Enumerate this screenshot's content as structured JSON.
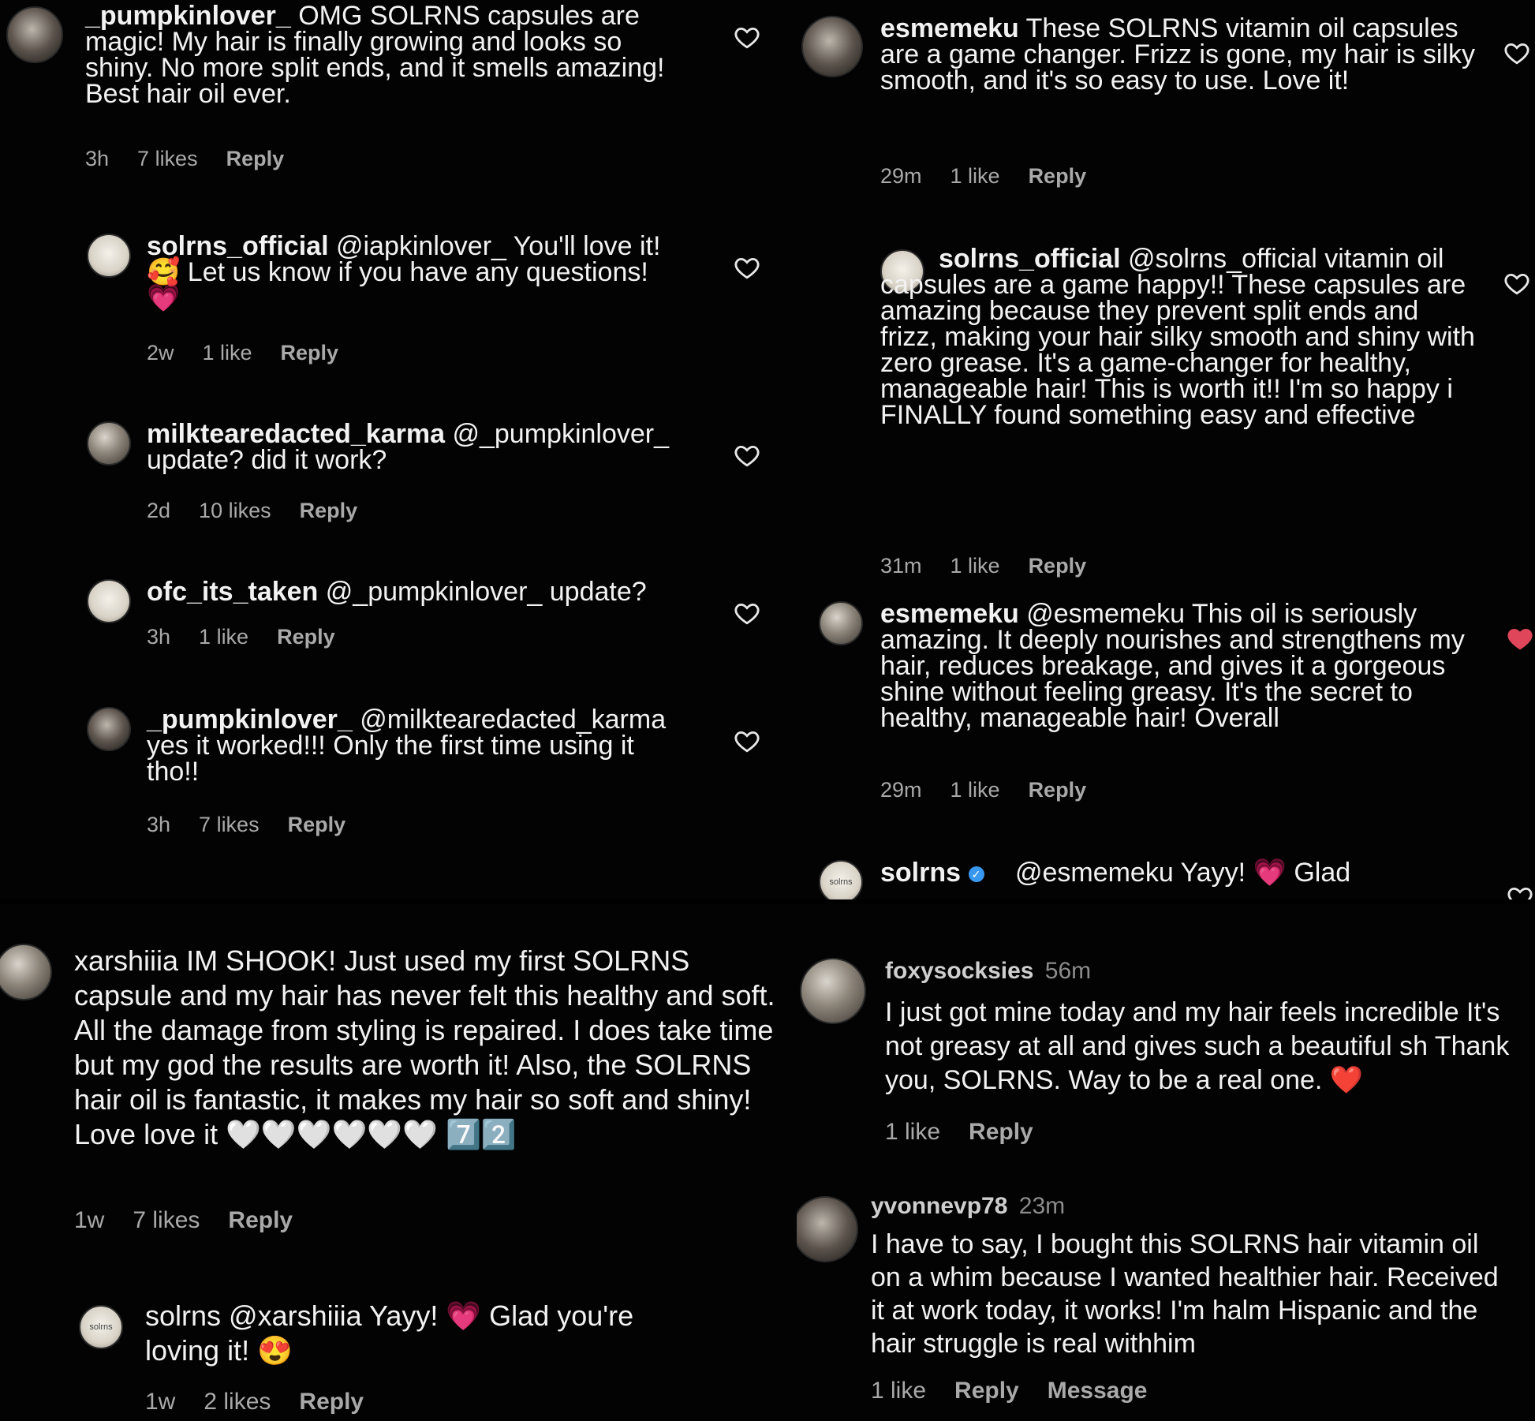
{
  "panels": {
    "top_left": {
      "comments": [
        {
          "username": "_pumpkinlover_",
          "text": "OMG SOLRNS capsules are magic! My hair is finally growing and looks so shiny. No more split ends, and it smells amazing! Best hair oil ever.",
          "time": "3h",
          "likes": "7 likes",
          "reply": "Reply"
        },
        {
          "username": "solrns_official",
          "text": "@iapkinlover_ You'll love it! 🥰 Let us know if you have any questions! 💗",
          "time": "2w",
          "likes": "1 like",
          "reply": "Reply"
        },
        {
          "username": "milktearedacted_karma",
          "text": "@_pumpkinlover_ update? did it work?",
          "time": "2d",
          "likes": "10 likes",
          "reply": "Reply"
        },
        {
          "username": "ofc_its_taken",
          "text": "@_pumpkinlover_ update?",
          "time": "3h",
          "likes": "1 like",
          "reply": "Reply"
        },
        {
          "username": "_pumpkinlover_",
          "text": "@milktearedacted_karma yes it worked!!! Only the first time using it tho!!",
          "time": "3h",
          "likes": "7 likes",
          "reply": "Reply"
        }
      ]
    },
    "top_right": {
      "comments": [
        {
          "username": "esmemeku",
          "text": "These SOLRNS vitamin oil capsules are a game changer. Frizz is gone, my hair is silky smooth, and it's so easy to use. Love it!",
          "time": "29m",
          "likes": "1 like",
          "reply": "Reply"
        },
        {
          "username": "solrns_official",
          "text": "@solrns_official vitamin oil capsules are a game happy!! These capsules are amazing because they prevent split ends and frizz, making your hair silky smooth and shiny with zero grease. It's a game-changer for healthy, manageable hair! This is worth it!! I'm so happy i FINALLY found something easy and effective",
          "time": "31m",
          "likes": "1 like",
          "reply": "Reply"
        },
        {
          "username": "esmemeku",
          "text": "@esmemeku This oil is seriously amazing. It deeply nourishes and strengthens my hair, reduces breakage, and gives it a gorgeous shine without feeling greasy. It's the secret to healthy, manageable hair! Overall",
          "time": "29m",
          "likes": "1 like",
          "reply": "Reply"
        },
        {
          "username": "solrns",
          "text": "@esmemeku Yayy! 💗 Glad",
          "avatar_label": "solrns"
        }
      ]
    },
    "bottom_left": {
      "comments": [
        {
          "username": "xarshiiia",
          "text": "IM SHOOK! Just used my first SOLRNS capsule and my hair has never felt this healthy and soft. All the damage from styling is repaired. I does take time but my god the results are worth it! Also, the SOLRNS hair oil is fantastic, it makes my hair so soft and shiny! Love love it 🤍🤍🤍🤍🤍🤍 7️⃣2️⃣",
          "time": "1w",
          "likes": "7 likes",
          "reply": "Reply"
        },
        {
          "username": "solrns",
          "text": "@xarshiiia Yayy! 💗 Glad you're loving it! 😍",
          "avatar_label": "solrns",
          "time": "1w",
          "likes": "2 likes",
          "reply": "Reply"
        }
      ]
    },
    "bottom_right": {
      "comments": [
        {
          "username": "foxysocksies",
          "time_inline": "56m",
          "text": "I just got mine today and my hair feels incredible It's not greasy at all and gives such a beautiful sh Thank you, SOLRNS. Way to be a real one. ❤️",
          "likes": "1 like",
          "reply": "Reply"
        },
        {
          "username": "yvonnevp78",
          "time_inline": "23m",
          "text": "I have to say, I bought this SOLRNS hair vitamin oil on a whim because I wanted healthier hair. Received it at work today, it works! I'm halm Hispanic and the hair struggle is real withhim",
          "likes": "1 like",
          "reply": "Reply",
          "message": "Message"
        }
      ]
    }
  },
  "colors": {
    "background": "#000000",
    "text": "#f2f2f2",
    "meta": "#a9a9a9",
    "liked_heart": "#e0465a"
  }
}
